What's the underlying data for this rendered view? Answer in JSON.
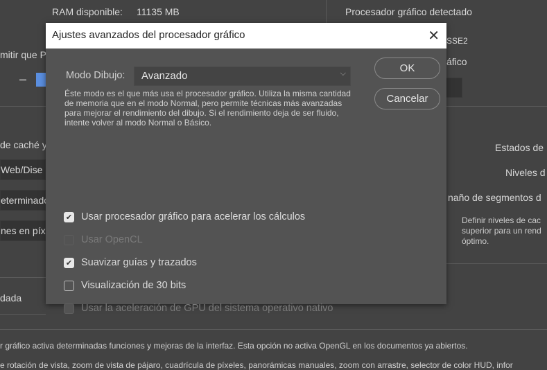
{
  "background": {
    "ram_label": "RAM disponible:",
    "ram_value": "11135 MB",
    "gpu_detected": "Procesador gráfico detectado",
    "gpu_name_fragment": "SSE2",
    "gpu_fragment": "áfico",
    "allow_fragment": "mitir que P",
    "cache_fragment": "de caché y",
    "field1": "Web/Dise",
    "field2": "eterminado",
    "field3": "nes en píx",
    "dada_fragment": "dada",
    "estados": "Estados de",
    "niveles": "Niveles d",
    "segmentos": "naño de segmentos d",
    "cache_desc": [
      "Definir niveles de cac",
      "superior para un rend",
      "óptimo."
    ],
    "footer1": "r gráfico activa determinadas funciones y mejoras de la interfaz. Esta opción no activa OpenGL en los documentos ya abiertos.",
    "footer2": "e rotación de vista, zoom de vista de pájaro, cuadrícula de píxeles, panorámicas manuales, zoom con arrastre, selector de color HUD, infor"
  },
  "dialog": {
    "title": "Ajustes avanzados del procesador gráfico",
    "mode_label": "Modo Dibujo:",
    "mode_value": "Avanzado",
    "mode_description": "Éste modo es el que más usa el procesador gráfico. Utiliza la misma cantidad de memoria que en el modo Normal, pero permite técnicas más avanzadas para mejorar el rendimiento del dibujo. Si el rendimiento deja de ser fluido, intente volver al modo Normal o Básico.",
    "ok": "OK",
    "cancel": "Cancelar",
    "checkboxes": [
      {
        "label": "Usar procesador gráfico para acelerar los cálculos",
        "checked": true,
        "enabled": true
      },
      {
        "label": "Usar OpenCL",
        "checked": false,
        "enabled": false
      },
      {
        "label": "Suavizar guías y trazados",
        "checked": true,
        "enabled": true
      },
      {
        "label": "Visualización de 30 bits",
        "checked": false,
        "enabled": true
      },
      {
        "label": "Usar la aceleración de GPU del sistema operativo nativo",
        "checked": false,
        "enabled": false
      }
    ]
  },
  "colors": {
    "accent": "#5b8fe0",
    "dialog_bg": "#535353",
    "page_bg": "#434343"
  }
}
